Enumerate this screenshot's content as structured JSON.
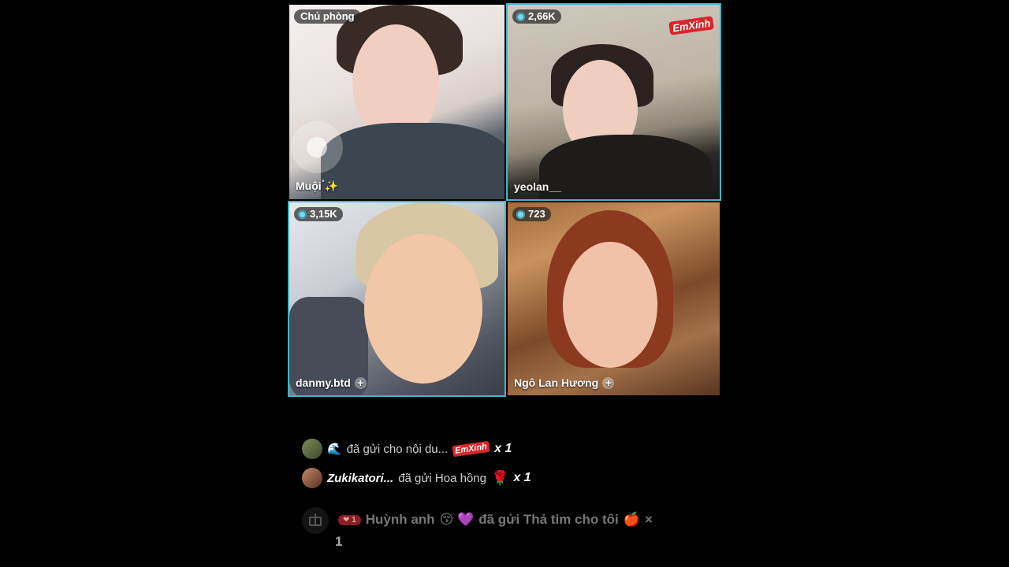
{
  "tiles": [
    {
      "badge": "Chủ phòng",
      "name": "Muội ̉✨"
    },
    {
      "viewers": "2,66K",
      "name": "yeolan__",
      "logo": "EmXinh"
    },
    {
      "viewers": "3,15K",
      "name": "danmy.btd"
    },
    {
      "viewers": "723",
      "name": "Ngô Lan Hương"
    }
  ],
  "gifts": [
    {
      "sender_icon": "🌊",
      "text": "đã gửi cho nội du...",
      "item_logo": "EmXinh",
      "count": "x 1"
    },
    {
      "sender": "Zukikatori...",
      "text": "đã gửi Hoa hồng",
      "item_icon": "🌹",
      "count": "x 1"
    }
  ],
  "ticker": {
    "level": "❤ 1",
    "sender": "Huỳnh anh",
    "emojis": "😚 💜",
    "text": "đã gửi Thả tim cho tôi",
    "gift_icon": "🍎",
    "multiplier": "×",
    "count": "1"
  },
  "colors": {
    "accent_border": "#3fb6c8",
    "logo_red": "#d8262b"
  }
}
